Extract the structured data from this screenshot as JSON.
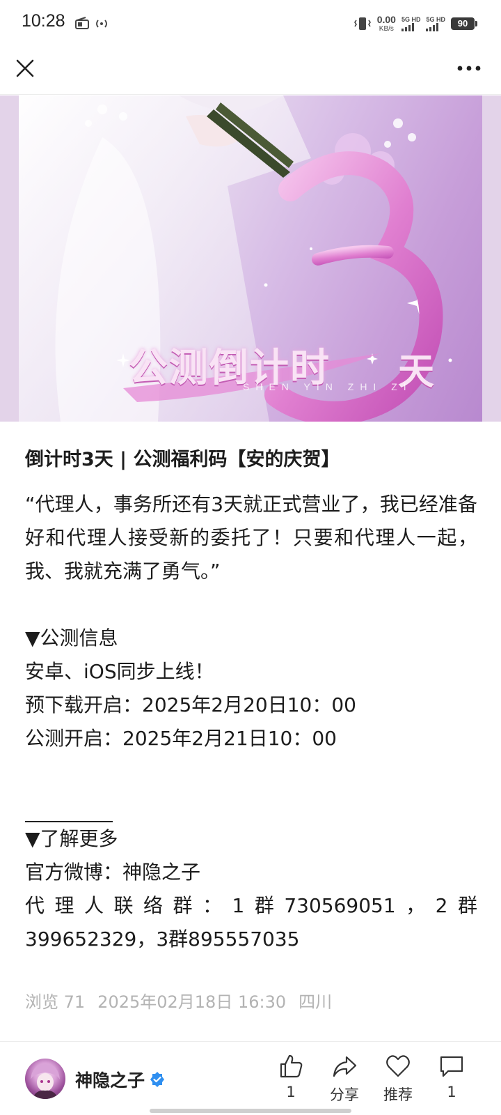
{
  "status_bar": {
    "time": "10:28",
    "net_speed_value": "0.00",
    "net_speed_unit": "KB/s",
    "sim1_label": "5G HD",
    "sim2_label": "5G HD",
    "battery": "90",
    "icons": [
      "radio-icon",
      "hotspot-icon",
      "vibrate-icon"
    ]
  },
  "top_bar": {
    "close_icon": "close-icon",
    "more_icon": "more-icon"
  },
  "banner": {
    "number": "3",
    "caption": "公测倒计时",
    "unit": "天",
    "subtitle": "SHEN YIN ZHI ZI"
  },
  "post": {
    "title": "倒计时3天 | 公测福利码【安的庆贺】",
    "quote": "“代理人，事务所还有3天就正式营业了，我已经准备好和代理人接受新的委托了！只要和代理人一起，我、我就充满了勇气。”",
    "section1_heading": "▼公测信息",
    "platform_line": "安卓、iOS同步上线！",
    "predownload_line": "预下载开启：2025年2月20日10：00",
    "launch_line": "公测开启：2025年2月21日10：00",
    "section2_heading": "▼了解更多",
    "weibo_line": "官方微博：神隐之子",
    "contact_line": "代理人联络群：1群730569051，2群399652329，3群895557035"
  },
  "meta": {
    "views": "浏览 71",
    "date": "2025年02月18日 16:30",
    "location": "四川"
  },
  "bottom_bar": {
    "author": "神隐之子",
    "like_count": "1",
    "share_label": "分享",
    "recommend_label": "推荐",
    "comment_count": "1"
  },
  "colors": {
    "banner_pink": "#d987cc",
    "banner_frame": "#e3d3e9",
    "meta_gray": "#b3b3b3",
    "verified_blue": "#2f8ff0"
  }
}
